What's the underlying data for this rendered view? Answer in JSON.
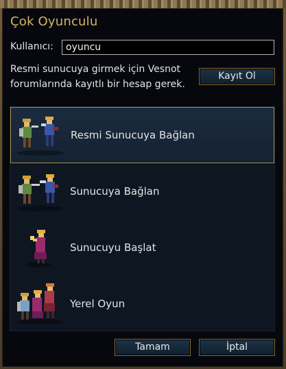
{
  "dialog": {
    "title": "Çok Oyunculu",
    "username_label": "Kullanıcı:",
    "username_value": "oyuncu",
    "info_text": "Resmi sunucuya girmek için Vesnot forumlarında kayıtlı bir hesap gerek.",
    "register_button": "Kayıt Ol"
  },
  "options": [
    {
      "label": "Resmi Sunucuya Bağlan",
      "icon": "two-warriors-sprite-icon",
      "selected": true
    },
    {
      "label": "Sunucuya Bağlan",
      "icon": "two-warriors-sprite-icon",
      "selected": false
    },
    {
      "label": "Sunucuyu Başlat",
      "icon": "mage-sprite-icon",
      "selected": false
    },
    {
      "label": "Yerel Oyun",
      "icon": "three-units-sprite-icon",
      "selected": false
    }
  ],
  "footer": {
    "ok_button": "Tamam",
    "cancel_button": "İptal"
  },
  "colors": {
    "title": "#d8b660",
    "button_border": "#8a6c33",
    "selection_border": "#a78c4e",
    "list_background": "#0e1622"
  }
}
